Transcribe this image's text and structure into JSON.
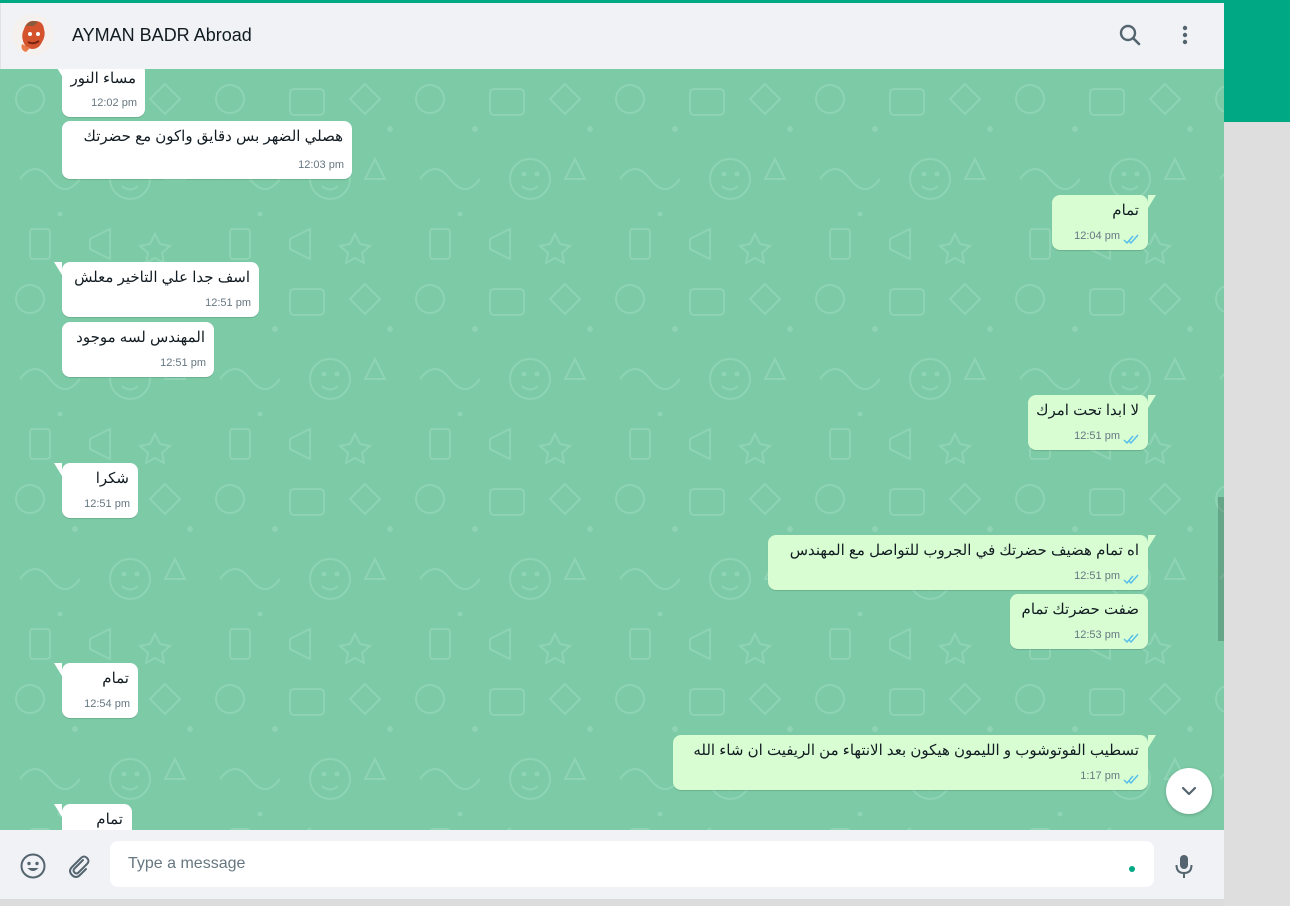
{
  "header": {
    "contact_name": "AYMAN BADR Abroad",
    "search_icon": "search-icon",
    "menu_icon": "vertical-dots-icon"
  },
  "messages": [
    {
      "dir": "in",
      "text": "مساء النور",
      "time": "12:02 pm"
    },
    {
      "dir": "in",
      "text": "هصلي الضهر بس دقايق واكون مع حضرتك",
      "time": "12:03 pm"
    },
    {
      "dir": "out",
      "text": "تمام",
      "time": "12:04 pm",
      "status": "read"
    },
    {
      "dir": "in",
      "text": "اسف جدا علي التاخير معلش",
      "time": "12:51 pm"
    },
    {
      "dir": "in",
      "text": "المهندس لسه موجود",
      "time": "12:51 pm"
    },
    {
      "dir": "out",
      "text": "لا ابدا تحت امرك",
      "time": "12:51 pm",
      "status": "read"
    },
    {
      "dir": "in",
      "text": "شكرا",
      "time": "12:51 pm"
    },
    {
      "dir": "out",
      "text": "اه تمام هضيف حضرتك في الجروب للتواصل مع المهندس",
      "time": "12:51 pm",
      "status": "read"
    },
    {
      "dir": "out",
      "text": "ضفت حضرتك تمام",
      "time": "12:53 pm",
      "status": "read"
    },
    {
      "dir": "in",
      "text": "تمام",
      "time": "12:54 pm"
    },
    {
      "dir": "out",
      "text": "تسطيب الفوتوشوب و الليمون هيكون بعد الانتهاء من الريفيت ان شاء الله",
      "time": "1:17 pm",
      "status": "read"
    },
    {
      "dir": "in",
      "text": "تمام",
      "time": ""
    }
  ],
  "footer": {
    "emoji_icon": "emoji-icon",
    "attach_icon": "paperclip-icon",
    "placeholder": "Type a message",
    "mic_icon": "microphone-icon"
  },
  "colors": {
    "accent": "#00a884",
    "chat_background": "#7ccaa6",
    "outgoing_bubble": "#d9fdd3",
    "incoming_bubble": "#ffffff",
    "read_ticks": "#53bdeb"
  }
}
